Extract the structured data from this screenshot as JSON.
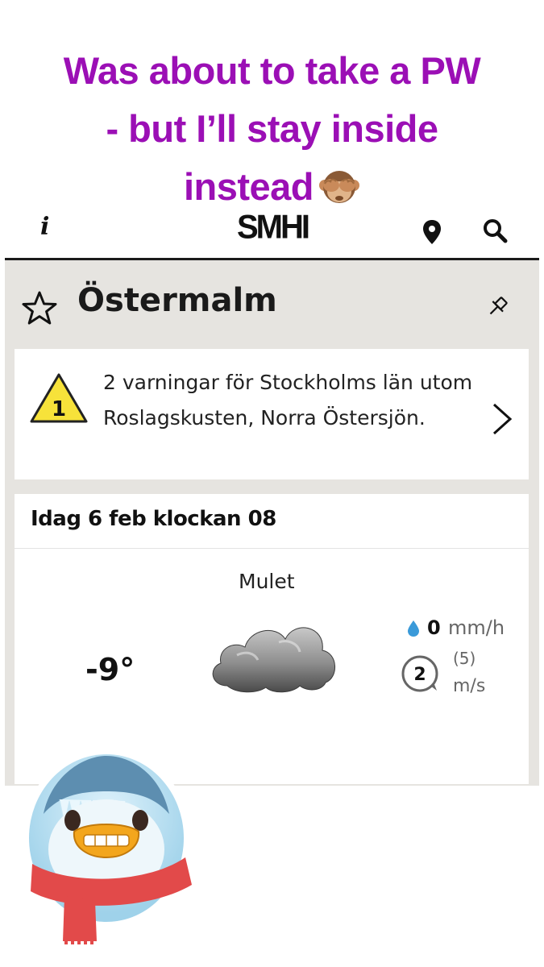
{
  "caption": {
    "line1": "Was about to take a PW",
    "line2": "- but I’ll stay inside",
    "line3": "instead"
  },
  "header": {
    "info_label": "i",
    "logo_text": "SMHI",
    "icons": [
      "info-icon",
      "location-pin-icon",
      "search-icon"
    ]
  },
  "location": {
    "name": "Östermalm",
    "icons": [
      "star-icon",
      "pushpin-icon"
    ]
  },
  "warning": {
    "level": "1",
    "text": "2 varningar för Stockholms län utom Roslagskusten, Norra Östersjön.",
    "colors": {
      "triangle_fill": "#f7e23a",
      "triangle_stroke": "#222222"
    }
  },
  "forecast": {
    "heading": "Idag 6 feb klockan 08",
    "condition": "Mulet",
    "temperature": "-9°",
    "precipitation": {
      "value": "0",
      "unit": "mm/h"
    },
    "wind": {
      "speed": "2",
      "gust": "(5)",
      "unit": "m/s"
    }
  },
  "colors": {
    "caption": "#9b0fb5",
    "panel_bg": "#e6e4e0",
    "drop": "#3a9ad9"
  }
}
